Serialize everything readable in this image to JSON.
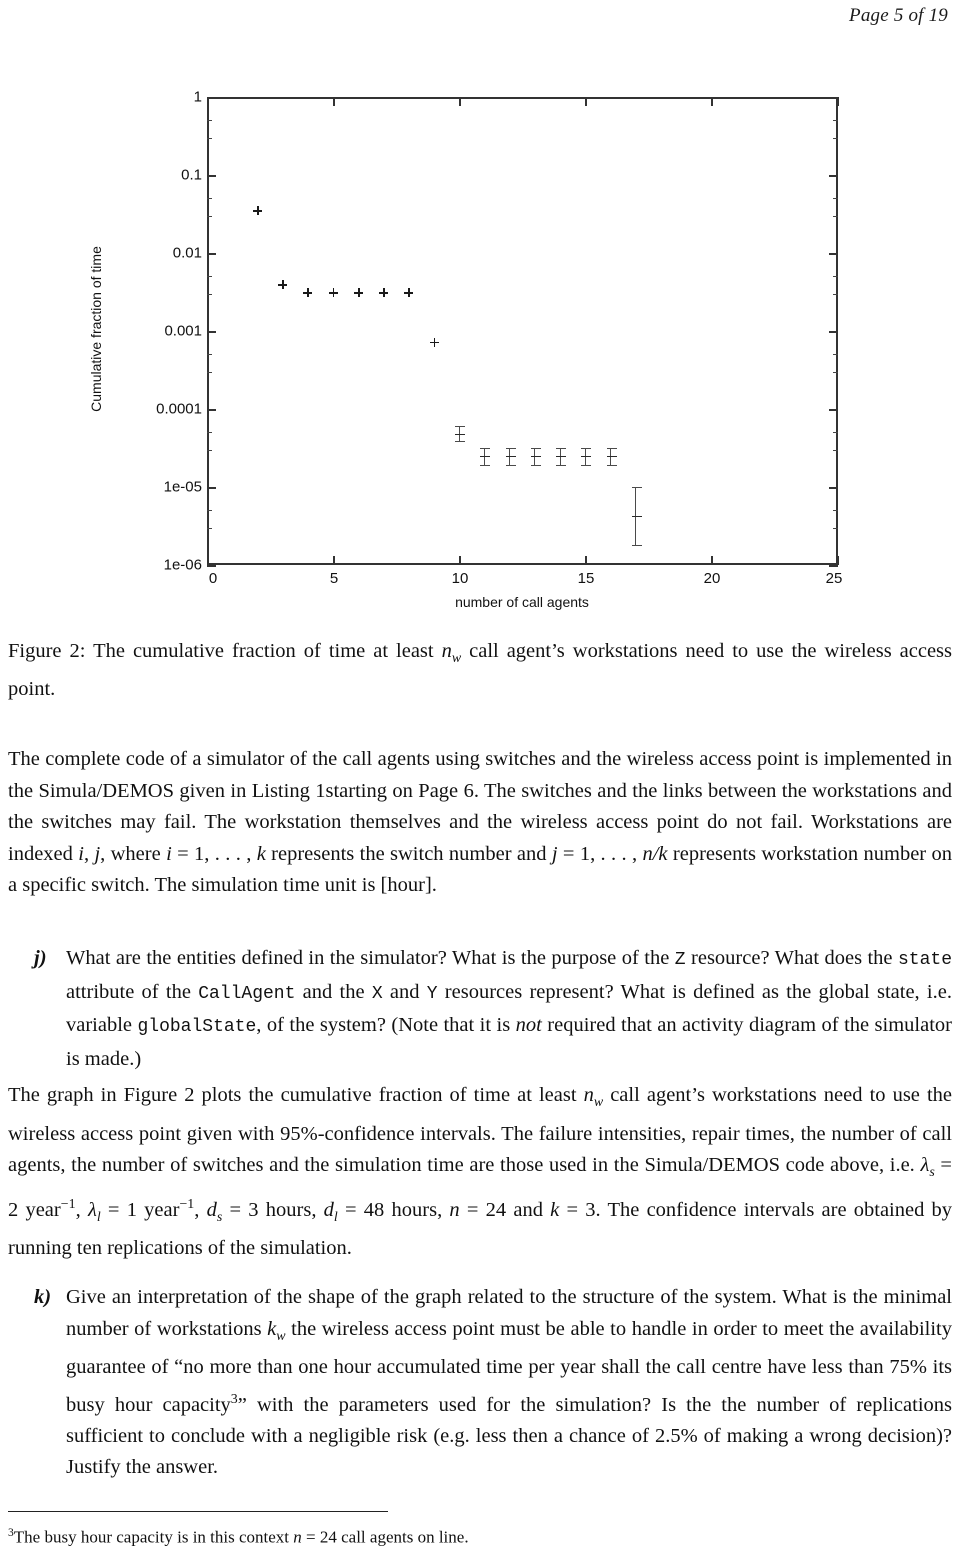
{
  "page": {
    "header": "Page 5 of 19"
  },
  "figure": {
    "caption_prefix": "Figure 2:",
    "caption_part1": " The cumulative fraction of time at least ",
    "caption_var": "n",
    "caption_var_sub": "w",
    "caption_part2": " call agent’s workstations need to use the wireless access point."
  },
  "chart_data": {
    "type": "scatter",
    "title": "",
    "xlabel": "number of call agents",
    "ylabel": "Cumulative fraction of time",
    "yscale": "log",
    "xlim": [
      0,
      25
    ],
    "ylim": [
      1e-06,
      1
    ],
    "grid": false,
    "legend": "none",
    "xticks": [
      "0",
      "5",
      "10",
      "15",
      "20",
      "25"
    ],
    "xtick_values": [
      0,
      5,
      10,
      15,
      20,
      25
    ],
    "yticks": [
      "1",
      "0.1",
      "0.01",
      "0.001",
      "0.0001",
      "1e-05",
      "1e-06"
    ],
    "ytick_values": [
      1,
      0.1,
      0.01,
      0.001,
      0.0001,
      1e-05,
      1e-06
    ],
    "marker": "plus",
    "series": [
      {
        "name": "cumulative fraction of time",
        "x": [
          2,
          3,
          4,
          5,
          6,
          7,
          8,
          9,
          10,
          11,
          12,
          13,
          14,
          15,
          16,
          17
        ],
        "y": [
          0.035,
          0.0039,
          0.0031,
          0.0031,
          0.0031,
          0.0031,
          0.0031,
          0.00072,
          4.8e-05,
          2.5e-05,
          2.5e-05,
          2.5e-05,
          2.5e-05,
          2.5e-05,
          2.5e-05,
          4.3e-06
        ],
        "y_low": [
          0.035,
          0.0039,
          0.0031,
          0.0031,
          0.0031,
          0.0031,
          0.0031,
          0.00068,
          3.9e-05,
          1.9e-05,
          1.9e-05,
          1.9e-05,
          1.9e-05,
          1.9e-05,
          1.9e-05,
          1.8e-06
        ],
        "y_high": [
          0.035,
          0.0039,
          0.0031,
          0.0031,
          0.0031,
          0.0031,
          0.0031,
          0.00076,
          5.9e-05,
          3.1e-05,
          3.1e-05,
          3.1e-05,
          3.1e-05,
          3.1e-05,
          3.1e-05,
          9.8e-06
        ],
        "errorbars": "95% confidence intervals"
      }
    ]
  },
  "body": {
    "p1": {
      "s1": "The complete code of a simulator of the call agents using switches and the wireless access point is implemented in the Simula/DEMOS given in Listing 1starting on Page 6. The switches and the links between the workstations and the switches may fail. The workstation themselves and the wireless access point do not fail. Workstations are indexed ",
      "idx_i": "i",
      "idx_sep": ", ",
      "idx_j": "j",
      "s2": ", where ",
      "eq1_var": "i",
      "eq1_rest": " = 1, . . . , ",
      "eq1_k": "k",
      "s3": " represents the switch number and ",
      "eq2_var": "j",
      "eq2_rest": " = 1, . . . , ",
      "eq2_nk": "n/k",
      "s4": " represents workstation number on a specific switch. The simulation time unit is [hour]."
    },
    "item_j": {
      "marker": "j)",
      "t1": "What are the entities defined in the simulator? What is the purpose of the ",
      "code_z": "Z",
      "t2": " resource? What does the ",
      "code_state": "state",
      "t3": " attribute of the ",
      "code_callagent": "CallAgent",
      "t4": " and the ",
      "code_x": "X",
      "t5": " and ",
      "code_y": "Y",
      "t6": " resources represent? What is defined as the global state, i.e. variable ",
      "code_globalstate": "globalState",
      "t7": ", of the system? (Note that it is ",
      "em_not": "not",
      "t8": " required that an activity diagram of the simulator is made.)"
    },
    "p2": {
      "s1": "The graph in Figure 2 plots the cumulative fraction of time at least ",
      "nw_n": "n",
      "nw_sub": "w",
      "s2": " call agent’s workstations need to use the wireless access point given with 95%-confidence intervals. The failure intensities, repair times, the number of call agents, the number of switches and the simulation time are those used in the Simula/DEMOS code above, i.e. ",
      "eq_lambda_s": "λ",
      "eq_lambda_s_sub": "s",
      "eq_lambda_s_val": " = 2 year",
      "eq_lambda_s_exp": "−1",
      "sep1": ", ",
      "eq_lambda_l": "λ",
      "eq_lambda_l_sub": "l",
      "eq_lambda_l_val": " = 1 year",
      "eq_lambda_l_exp": "−1",
      "sep2": ", ",
      "eq_ds": "d",
      "eq_ds_sub": "s",
      "eq_ds_val": " = 3 hours",
      "sep3": ", ",
      "eq_dl": "d",
      "eq_dl_sub": "l",
      "eq_dl_val": " = 48 hours",
      "sep4": ", ",
      "eq_n": "n",
      "eq_n_val": " = 24 and ",
      "eq_k": "k",
      "eq_k_val": " = 3",
      "s3": ". The confidence intervals are obtained by running ten replications of the simulation."
    },
    "item_k": {
      "marker": "k)",
      "t1": "Give an interpretation of the shape of the graph related to the structure of the system. What is the minimal number of workstations ",
      "kw_k": "k",
      "kw_sub": "w",
      "t2": " the wireless access point must be able to handle in order to meet the availability guarantee of “no more than one hour accumulated time per year shall the call centre have less than 75% its busy hour capacity",
      "fn_marker": "3",
      "t3": "” with the parameters used for the simulation? Is the the number of replications sufficient to conclude with a negligible risk (e.g. less then a chance of 2.5% of making a wrong decision)? Justify the answer."
    },
    "footnote": {
      "marker": "3",
      "t1": "The busy hour capacity is in this context ",
      "var_n": "n",
      "t2": " = 24 call agents on line."
    }
  }
}
